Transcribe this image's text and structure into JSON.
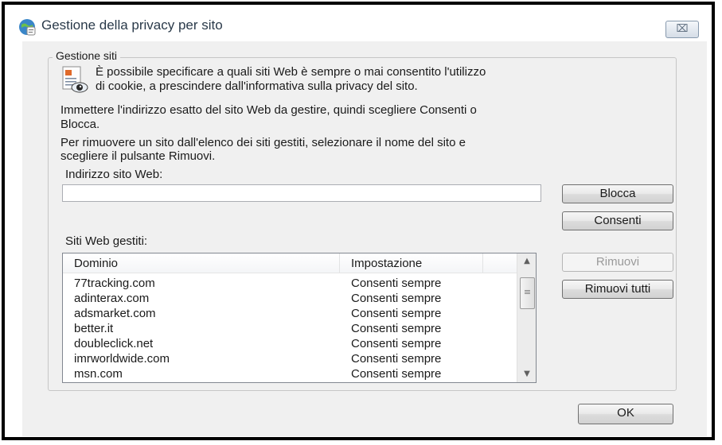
{
  "dialog": {
    "title": "Gestione della privacy per sito",
    "close_glyph": "⌧"
  },
  "group": {
    "label": "Gestione siti",
    "intro_line1": "È possibile specificare a quali siti Web è sempre o mai consentito l'utilizzo",
    "intro_line2": "di cookie, a prescindere dall'informativa sulla privacy del sito.",
    "instr1_line1": "Immettere l'indirizzo esatto del sito Web da gestire, quindi scegliere Consenti o",
    "instr1_line2": "Blocca.",
    "instr2_line1": "Per rimuovere un sito dall'elenco dei siti gestiti, selezionare il nome del sito e",
    "instr2_line2": "scegliere il pulsante Rimuovi."
  },
  "address": {
    "label": "Indirizzo sito Web:",
    "value": ""
  },
  "buttons": {
    "block": "Blocca",
    "allow": "Consenti",
    "remove": "Rimuovi",
    "remove_all": "Rimuovi tutti",
    "ok": "OK"
  },
  "managed": {
    "label": "Siti Web gestiti:",
    "columns": [
      "Dominio",
      "Impostazione"
    ],
    "rows": [
      {
        "domain": "77tracking.com",
        "setting": "Consenti sempre"
      },
      {
        "domain": "adinterax.com",
        "setting": "Consenti sempre"
      },
      {
        "domain": "adsmarket.com",
        "setting": "Consenti sempre"
      },
      {
        "domain": "better.it",
        "setting": "Consenti sempre"
      },
      {
        "domain": "doubleclick.net",
        "setting": "Consenti sempre"
      },
      {
        "domain": "imrworldwide.com",
        "setting": "Consenti sempre"
      },
      {
        "domain": "msn.com",
        "setting": "Consenti sempre"
      }
    ]
  },
  "icons": {
    "title_icon": "globe-privacy-icon",
    "group_icon": "privacy-document-eye-icon"
  }
}
